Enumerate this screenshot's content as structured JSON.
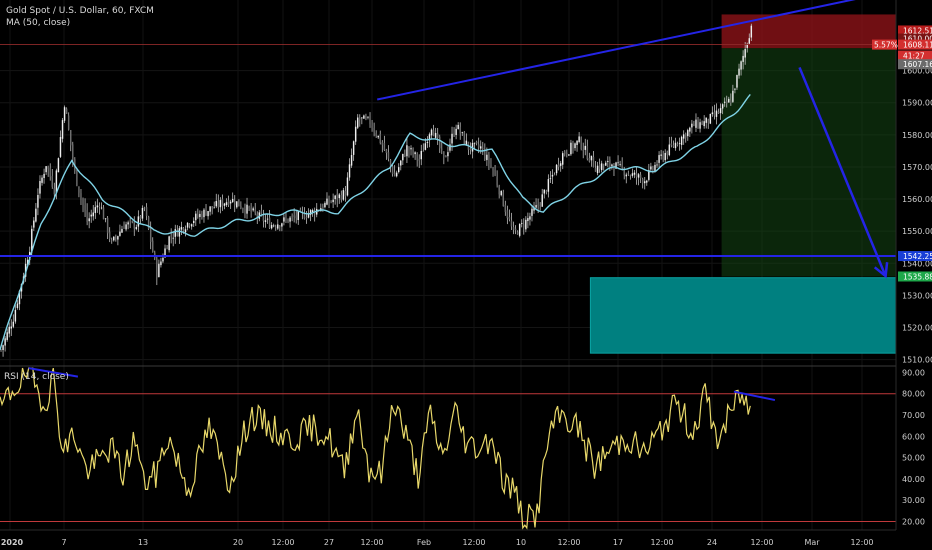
{
  "header": {
    "symbol_title": "Gold Spot / U.S. Dollar, 60, FXCM",
    "ma_label": "MA (50, close)",
    "rsi_label": "RSI (14, close)"
  },
  "price_axis": {
    "ticks": [
      "1600.00",
      "1590.00",
      "1580.00",
      "1570.00",
      "1560.00",
      "1550.00",
      "1540.00",
      "1530.00",
      "1520.00",
      "1510.00"
    ],
    "tick_values": [
      1600,
      1590,
      1580,
      1570,
      1560,
      1550,
      1540,
      1530,
      1520,
      1510
    ],
    "range": [
      1508,
      1622
    ]
  },
  "rsi_axis": {
    "ticks": [
      "90.00",
      "80.00",
      "70.00",
      "60.00",
      "50.00",
      "40.00",
      "30.00",
      "20.00"
    ],
    "tick_values": [
      90,
      80,
      70,
      60,
      50,
      40,
      30,
      20
    ],
    "range": [
      16,
      93
    ]
  },
  "time_axis": {
    "labels": [
      "2020",
      "7",
      "13",
      "20",
      "12:00",
      "27",
      "12:00",
      "Feb",
      "12:00",
      "10",
      "12:00",
      "17",
      "12:00",
      "24",
      "12:00",
      "Mar",
      "12:00"
    ]
  },
  "price_tags": [
    {
      "text": "1612.51",
      "value": 1612.51,
      "color": "#b71c1c",
      "text_class": "light"
    },
    {
      "text": "1610.00",
      "value": 1610.0,
      "color": "#7a1414",
      "text_class": "light"
    },
    {
      "text": "1608.11",
      "value": 1608.11,
      "color": "#d32f2f",
      "text_class": "light"
    },
    {
      "text": "41:27",
      "value": 1604.7,
      "color": "#d32f2f",
      "text_class": "light"
    },
    {
      "text": "1607.16",
      "value": 1602.0,
      "color": "#6b6b6b",
      "text_class": "light"
    },
    {
      "text": "1542.25",
      "value": 1542.25,
      "color": "#1a3fd6",
      "text_class": "light"
    },
    {
      "text": "1535.88",
      "value": 1535.88,
      "color": "#1ea84a",
      "text_class": "light"
    }
  ],
  "percent_tag": {
    "text": "5.57%",
    "value": 1608.11
  },
  "chart_data": [
    {
      "type": "candlestick",
      "title": "Gold Spot / U.S. Dollar, 60, FXCM",
      "series": [
        {
          "name": "Gold Spot / U.S. Dollar",
          "color": "#e8e8e8"
        },
        {
          "name": "MA (50, close)",
          "color": "#7fd3e6"
        }
      ],
      "price_anchors": [
        [
          0,
          1513
        ],
        [
          6,
          1523
        ],
        [
          14,
          1545
        ],
        [
          18,
          1562
        ],
        [
          22,
          1571
        ],
        [
          26,
          1563
        ],
        [
          31,
          1590
        ],
        [
          36,
          1568
        ],
        [
          42,
          1553
        ],
        [
          48,
          1559
        ],
        [
          54,
          1546
        ],
        [
          60,
          1552
        ],
        [
          66,
          1552
        ],
        [
          70,
          1557
        ],
        [
          76,
          1537
        ],
        [
          82,
          1548
        ],
        [
          92,
          1553
        ],
        [
          102,
          1557
        ],
        [
          112,
          1560
        ],
        [
          122,
          1556
        ],
        [
          132,
          1552
        ],
        [
          142,
          1554
        ],
        [
          152,
          1556
        ],
        [
          160,
          1559
        ],
        [
          168,
          1562
        ],
        [
          174,
          1585
        ],
        [
          180,
          1584
        ],
        [
          186,
          1577
        ],
        [
          192,
          1567
        ],
        [
          198,
          1576
        ],
        [
          204,
          1572
        ],
        [
          210,
          1583
        ],
        [
          216,
          1572
        ],
        [
          222,
          1583
        ],
        [
          228,
          1576
        ],
        [
          234,
          1576
        ],
        [
          240,
          1569
        ],
        [
          246,
          1557
        ],
        [
          250,
          1549
        ],
        [
          256,
          1553
        ],
        [
          262,
          1558
        ],
        [
          268,
          1566
        ],
        [
          274,
          1574
        ],
        [
          282,
          1578
        ],
        [
          290,
          1570
        ],
        [
          298,
          1571
        ],
        [
          306,
          1568
        ],
        [
          314,
          1566
        ],
        [
          322,
          1573
        ],
        [
          330,
          1578
        ],
        [
          338,
          1583
        ],
        [
          344,
          1584
        ],
        [
          350,
          1587
        ],
        [
          356,
          1591
        ],
        [
          361,
          1602
        ],
        [
          366,
          1614
        ]
      ],
      "ma_anchors": [
        [
          0,
          1513
        ],
        [
          20,
          1552
        ],
        [
          35,
          1572
        ],
        [
          50,
          1560
        ],
        [
          75,
          1550
        ],
        [
          95,
          1549
        ],
        [
          115,
          1553
        ],
        [
          140,
          1556
        ],
        [
          165,
          1556
        ],
        [
          190,
          1570
        ],
        [
          200,
          1580
        ],
        [
          220,
          1577
        ],
        [
          240,
          1575
        ],
        [
          255,
          1560
        ],
        [
          265,
          1556
        ],
        [
          280,
          1563
        ],
        [
          300,
          1570
        ],
        [
          320,
          1569
        ],
        [
          340,
          1576
        ],
        [
          360,
          1588
        ],
        [
          366,
          1592
        ]
      ],
      "trendlines": [
        {
          "name": "upper-trendline",
          "points": [
            [
              184,
              1591
            ],
            [
              430,
              1624
            ]
          ]
        },
        {
          "name": "support-line",
          "points": [
            [
              0,
              1542.25
            ],
            [
              516,
              1542.25
            ]
          ]
        }
      ],
      "arrow": {
        "from": [
          390,
          1601
        ],
        "to": [
          432,
          1536
        ]
      },
      "zones": [
        {
          "name": "stop-loss-zone",
          "x": [
            352,
            474
          ],
          "y": [
            1607,
            1617.5
          ]
        },
        {
          "name": "target-zone",
          "x": [
            352,
            474
          ],
          "y": [
            1535.88,
            1607
          ]
        },
        {
          "name": "teal-box",
          "x": [
            288,
            496
          ],
          "y": [
            1512,
            1535.5
          ]
        }
      ]
    },
    {
      "type": "line",
      "title": "RSI (14, close)",
      "series": [
        {
          "name": "RSI (14, close)",
          "color": "#e8d86a"
        }
      ],
      "levels": [
        80,
        20
      ],
      "rsi_anchors": [
        [
          0,
          72
        ],
        [
          6,
          82
        ],
        [
          14,
          90
        ],
        [
          18,
          82
        ],
        [
          22,
          76
        ],
        [
          26,
          88
        ],
        [
          31,
          52
        ],
        [
          36,
          62
        ],
        [
          42,
          44
        ],
        [
          48,
          48
        ],
        [
          54,
          55
        ],
        [
          60,
          42
        ],
        [
          66,
          60
        ],
        [
          70,
          38
        ],
        [
          76,
          42
        ],
        [
          82,
          60
        ],
        [
          92,
          35
        ],
        [
          102,
          64
        ],
        [
          112,
          38
        ],
        [
          122,
          70
        ],
        [
          132,
          64
        ],
        [
          142,
          58
        ],
        [
          152,
          64
        ],
        [
          160,
          60
        ],
        [
          168,
          43
        ],
        [
          174,
          74
        ],
        [
          180,
          45
        ],
        [
          186,
          42
        ],
        [
          192,
          78
        ],
        [
          198,
          60
        ],
        [
          204,
          42
        ],
        [
          210,
          70
        ],
        [
          216,
          50
        ],
        [
          222,
          72
        ],
        [
          228,
          56
        ],
        [
          234,
          55
        ],
        [
          240,
          60
        ],
        [
          246,
          38
        ],
        [
          250,
          36
        ],
        [
          256,
          20
        ],
        [
          262,
          24
        ],
        [
          268,
          62
        ],
        [
          274,
          70
        ],
        [
          282,
          64
        ],
        [
          290,
          46
        ],
        [
          298,
          54
        ],
        [
          306,
          60
        ],
        [
          314,
          52
        ],
        [
          322,
          62
        ],
        [
          330,
          76
        ],
        [
          338,
          62
        ],
        [
          344,
          80
        ],
        [
          350,
          58
        ],
        [
          356,
          70
        ],
        [
          361,
          80
        ],
        [
          366,
          72
        ]
      ],
      "rsi_trendlines": [
        {
          "name": "rsi-high-trendline",
          "points": [
            [
              14,
              92
            ],
            [
              38,
              88
            ]
          ]
        },
        {
          "name": "rsi-recent-trendline",
          "points": [
            [
              358,
              81
            ],
            [
              378,
              77
            ]
          ]
        }
      ]
    }
  ]
}
